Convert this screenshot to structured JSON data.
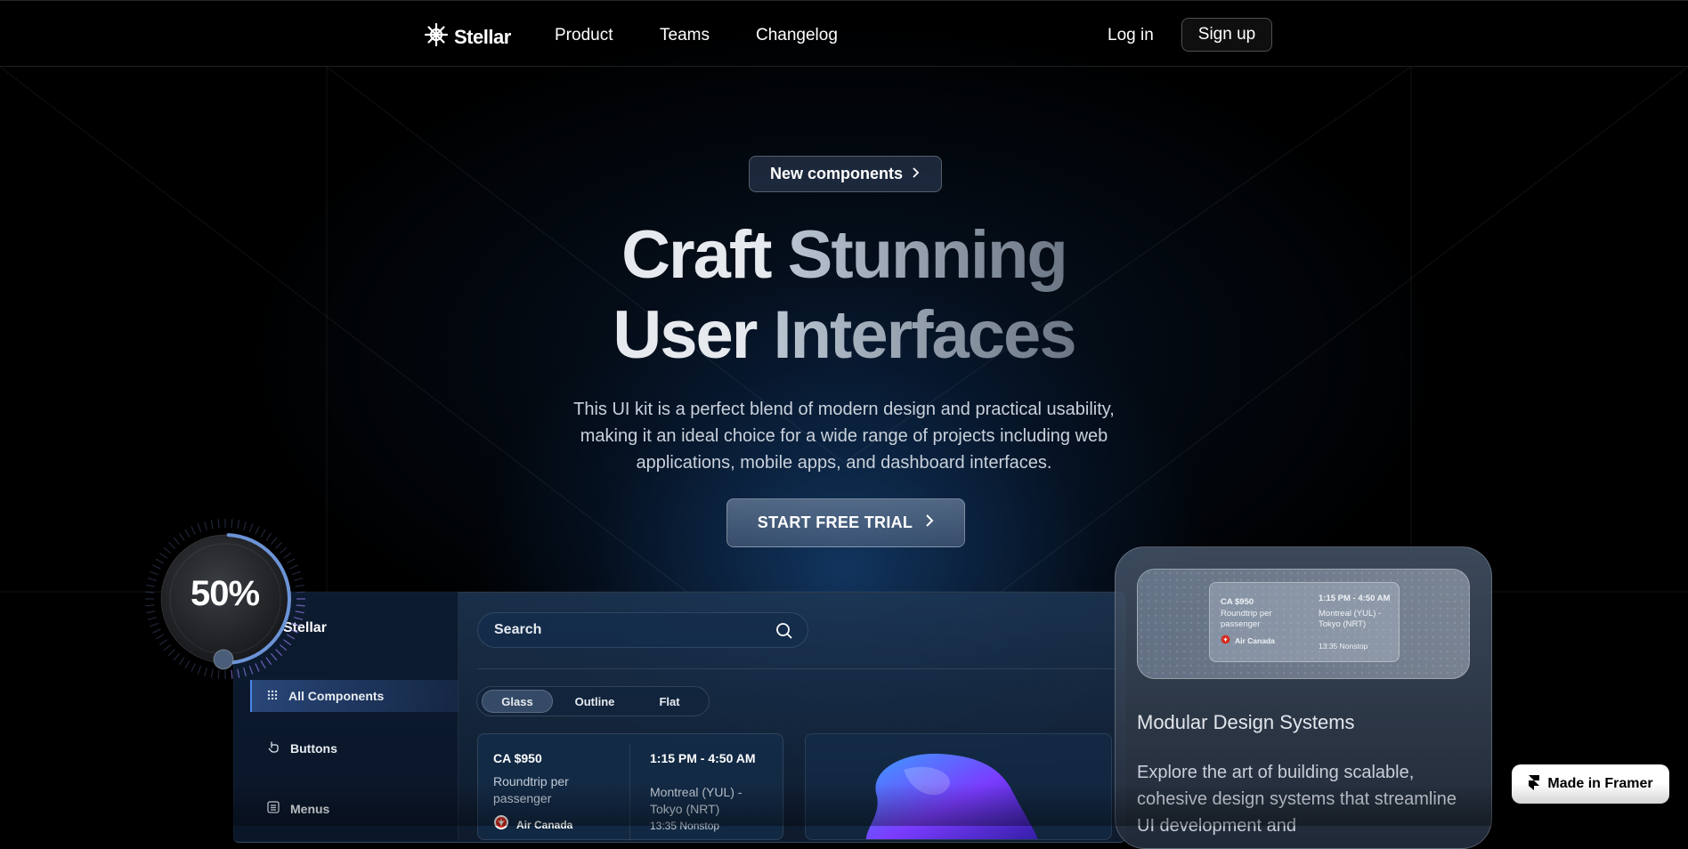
{
  "brand": {
    "name": "Stellar"
  },
  "nav": {
    "links": [
      "Product",
      "Teams",
      "Changelog"
    ],
    "login": "Log in",
    "signup": "Sign up"
  },
  "hero": {
    "pill": "New components",
    "title_line1_a": "Craft",
    "title_line1_b": "Stunning",
    "title_line2_a": "User",
    "title_line2_b": "Interfaces",
    "subtitle": "This UI kit is a perfect blend of modern design and practical usability, making it an ideal choice for a wide range of projects including web applications, mobile apps, and dashboard interfaces.",
    "cta": "START FREE TRIAL"
  },
  "gauge": {
    "value_label": "50%",
    "value": 0.5
  },
  "dashboard": {
    "brand": "Stellar",
    "sidebar": [
      {
        "label": "All Components",
        "icon": "grid-icon"
      },
      {
        "label": "Buttons",
        "icon": "pointer-hand-icon"
      },
      {
        "label": "Menus",
        "icon": "list-icon"
      }
    ],
    "search_placeholder": "Search",
    "tabs": [
      "Glass",
      "Outline",
      "Flat"
    ],
    "flight": {
      "price": "CA $950",
      "fare_note": "Roundtrip per passenger",
      "airline": "Air Canada",
      "time": "1:15 PM - 4:50 AM",
      "route": "Montreal (YUL) - Tokyo (NRT)",
      "duration": "13:35 Nonstop"
    }
  },
  "feature_card": {
    "title": "Modular Design Systems",
    "body": "Explore the art of building scalable, cohesive design systems that streamline UI development and"
  },
  "framer_badge": "Made in Framer",
  "colors": {
    "accent": "#4e86e6",
    "background": "#000000"
  }
}
